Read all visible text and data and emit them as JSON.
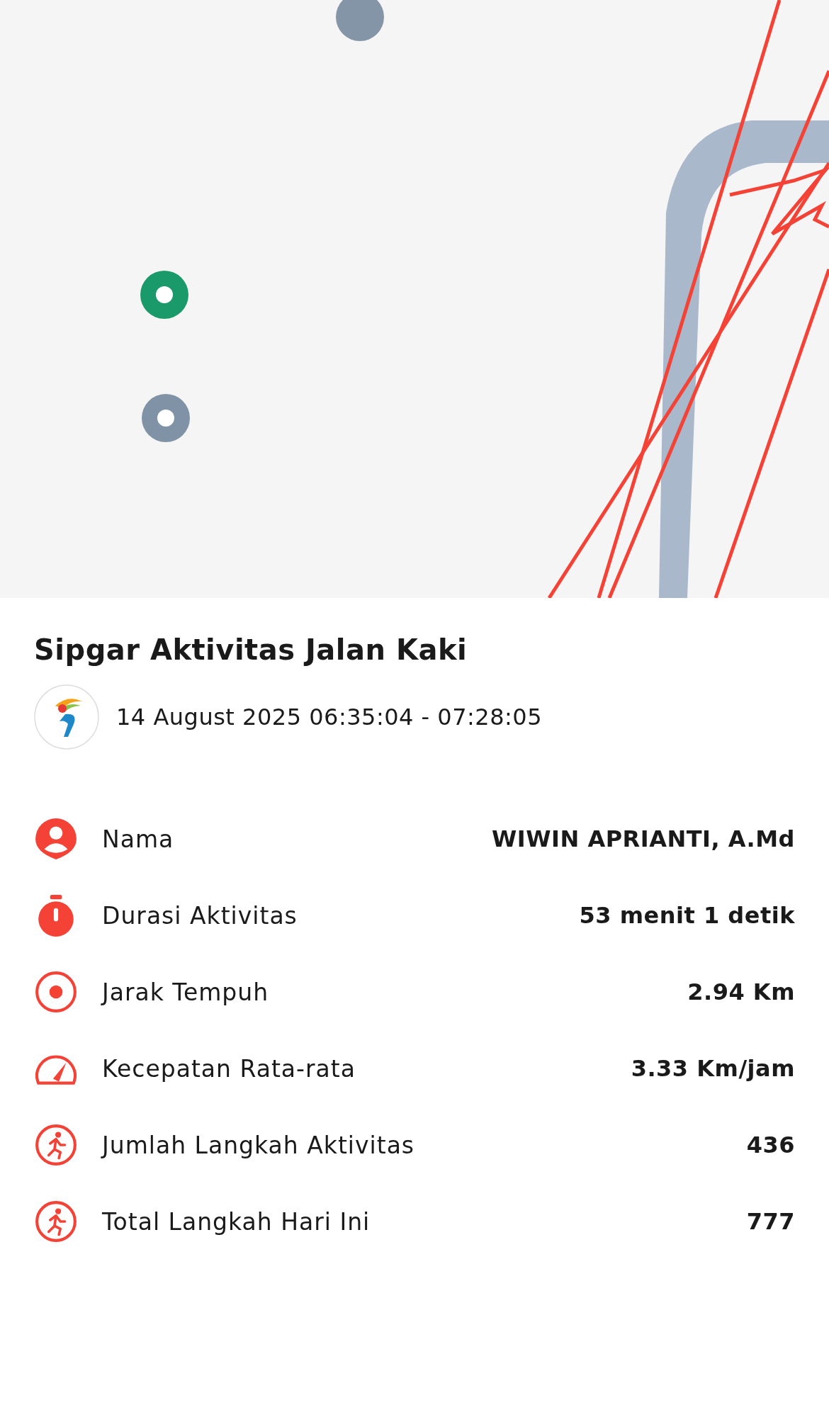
{
  "activity": {
    "title": "Sipgar Aktivitas Jalan Kaki",
    "time_range": "14 August 2025 06:35:04 - 07:28:05"
  },
  "stats": [
    {
      "kind": "person",
      "label": "Nama",
      "value": "WIWIN APRIANTI, A.Md"
    },
    {
      "kind": "timer",
      "label": "Durasi Aktivitas",
      "value": "53 menit 1 detik"
    },
    {
      "kind": "target",
      "label": "Jarak Tempuh",
      "value": "2.94 Km"
    },
    {
      "kind": "speed",
      "label": "Kecepatan Rata-rata",
      "value": "3.33 Km/jam"
    },
    {
      "kind": "steps",
      "label": "Jumlah Langkah Aktivitas",
      "value": "436"
    },
    {
      "kind": "steps",
      "label": "Total Langkah Hari Ini",
      "value": "777"
    }
  ]
}
